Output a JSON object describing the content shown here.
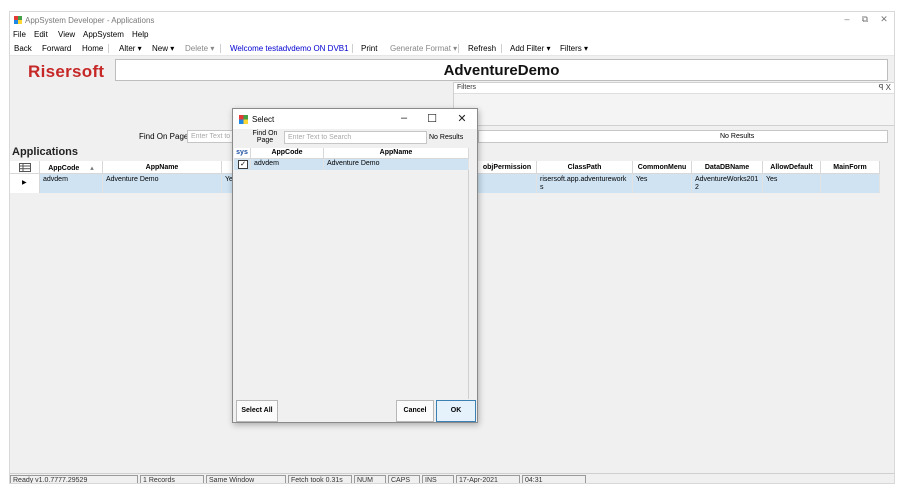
{
  "window": {
    "title": "AppSystem Developer - Applications"
  },
  "menubar": [
    "File",
    "Edit",
    "View",
    "AppSystem",
    "Help"
  ],
  "toolbar": {
    "back": "Back",
    "forward": "Forward",
    "home": "Home",
    "alter": "Alter ▾",
    "new": "New ▾",
    "delete": "Delete ▾",
    "welcome": "Welcome testadvdemo ON DVB1",
    "print": "Print",
    "generate_format": "Generate Format ▾",
    "refresh": "Refresh",
    "add_filter": "Add Filter ▾",
    "filters": "Filters ▾"
  },
  "logo": "Risersoft",
  "banner_title": "AdventureDemo",
  "filters_panel": {
    "label": "Filters",
    "controls": "ꟼ X"
  },
  "find": {
    "label": "Find On Page",
    "placeholder": "Enter Text to Search",
    "no_results": "No Results"
  },
  "section_title": "Applications",
  "grid": {
    "columns": [
      "AppCode",
      "AppName",
      "objPermission",
      "ClassPath",
      "CommonMenu",
      "DataDBName",
      "AllowDefault",
      "MainForm"
    ],
    "rows": [
      {
        "AppCode": "advdem",
        "AppName": "Adventure Demo",
        "hidden_fragment": "Ye",
        "objPermission": "",
        "ClassPath": "risersoft.app.adventureworks",
        "CommonMenu": "Yes",
        "DataDBName": "AdventureWorks2012",
        "AllowDefault": "Yes",
        "MainForm": ""
      }
    ],
    "sort_indicator": "▴",
    "row_marker": "▶"
  },
  "status_bar": [
    "Ready v1.0.7777.29529",
    "1 Records",
    "Same Window",
    "Fetch took 0.31s",
    "NUM",
    "CAPS",
    "INS",
    "17-Apr-2021",
    "04:31"
  ],
  "dialog": {
    "title": "Select",
    "find_label": "Find On Page",
    "find_placeholder": "Enter Text to Search",
    "no_results": "No Results",
    "columns": {
      "sys": "sys",
      "appcode": "AppCode",
      "appname": "AppName"
    },
    "rows": [
      {
        "checked": "✓",
        "AppCode": "advdem",
        "AppName": "Adventure Demo"
      }
    ],
    "select_all": "Select All",
    "cancel": "Cancel",
    "ok": "OK"
  },
  "colors": {
    "accent": "#c62828",
    "selection": "#cfe3f3",
    "link": "#0000d0"
  }
}
